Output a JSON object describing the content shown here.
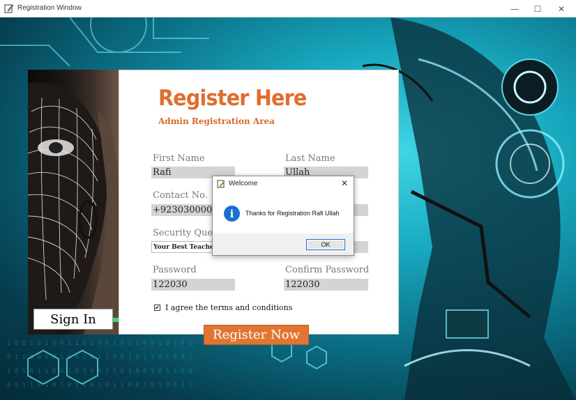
{
  "window": {
    "title": "Registration Window",
    "controls": {
      "minimize": "—",
      "maximize": "☐",
      "close": "✕"
    }
  },
  "sidebar": {
    "signin_label": "Sign In"
  },
  "form": {
    "heading": "Register Here",
    "subheading": "Admin Registration Area",
    "fields": {
      "first_name": {
        "label": "First Name",
        "value": "Rafi"
      },
      "last_name": {
        "label": "Last Name",
        "value": "Ullah"
      },
      "contact": {
        "label": "Contact No.",
        "value": "+92303000000"
      },
      "security_question": {
        "label": "Security Ques",
        "value": "Your Best Teacher N"
      },
      "password": {
        "label": "Password",
        "value": "122030"
      },
      "confirm_password": {
        "label": "Confirm Password",
        "value": "122030"
      }
    },
    "agree": {
      "checked": true,
      "label": "I agree the terms and conditions"
    },
    "register_button": "Register Now"
  },
  "dialog": {
    "title": "Welcome",
    "message": "Thanks for Registration Rafi Ullah",
    "ok_label": "OK",
    "icon": "info-icon"
  },
  "colors": {
    "accent": "#e07533",
    "info_blue": "#1a6fd1",
    "field_bg": "#d4d4d4"
  }
}
